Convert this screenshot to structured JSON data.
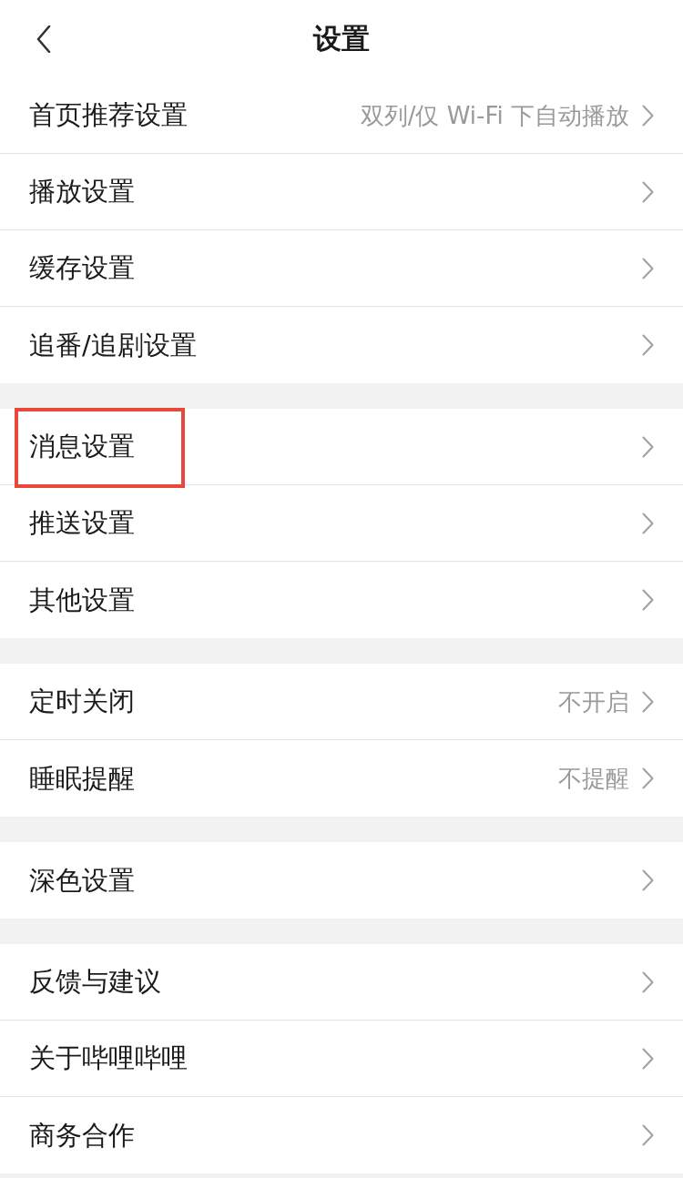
{
  "header": {
    "title": "设置"
  },
  "groups": [
    {
      "items": [
        {
          "label": "首页推荐设置",
          "value": "双列/仅 Wi-Fi 下自动播放",
          "highlighted": false
        },
        {
          "label": "播放设置",
          "highlighted": false
        },
        {
          "label": "缓存设置",
          "highlighted": false
        },
        {
          "label": "追番/追剧设置",
          "highlighted": false
        }
      ]
    },
    {
      "items": [
        {
          "label": "消息设置",
          "highlighted": true
        },
        {
          "label": "推送设置",
          "highlighted": false
        },
        {
          "label": "其他设置",
          "highlighted": false
        }
      ]
    },
    {
      "items": [
        {
          "label": "定时关闭",
          "value": "不开启",
          "highlighted": false
        },
        {
          "label": "睡眠提醒",
          "value": "不提醒",
          "highlighted": false
        }
      ]
    },
    {
      "items": [
        {
          "label": "深色设置",
          "highlighted": false
        }
      ]
    },
    {
      "items": [
        {
          "label": "反馈与建议",
          "highlighted": false
        },
        {
          "label": "关于哔哩哔哩",
          "highlighted": false
        },
        {
          "label": "商务合作",
          "highlighted": false
        }
      ]
    }
  ]
}
